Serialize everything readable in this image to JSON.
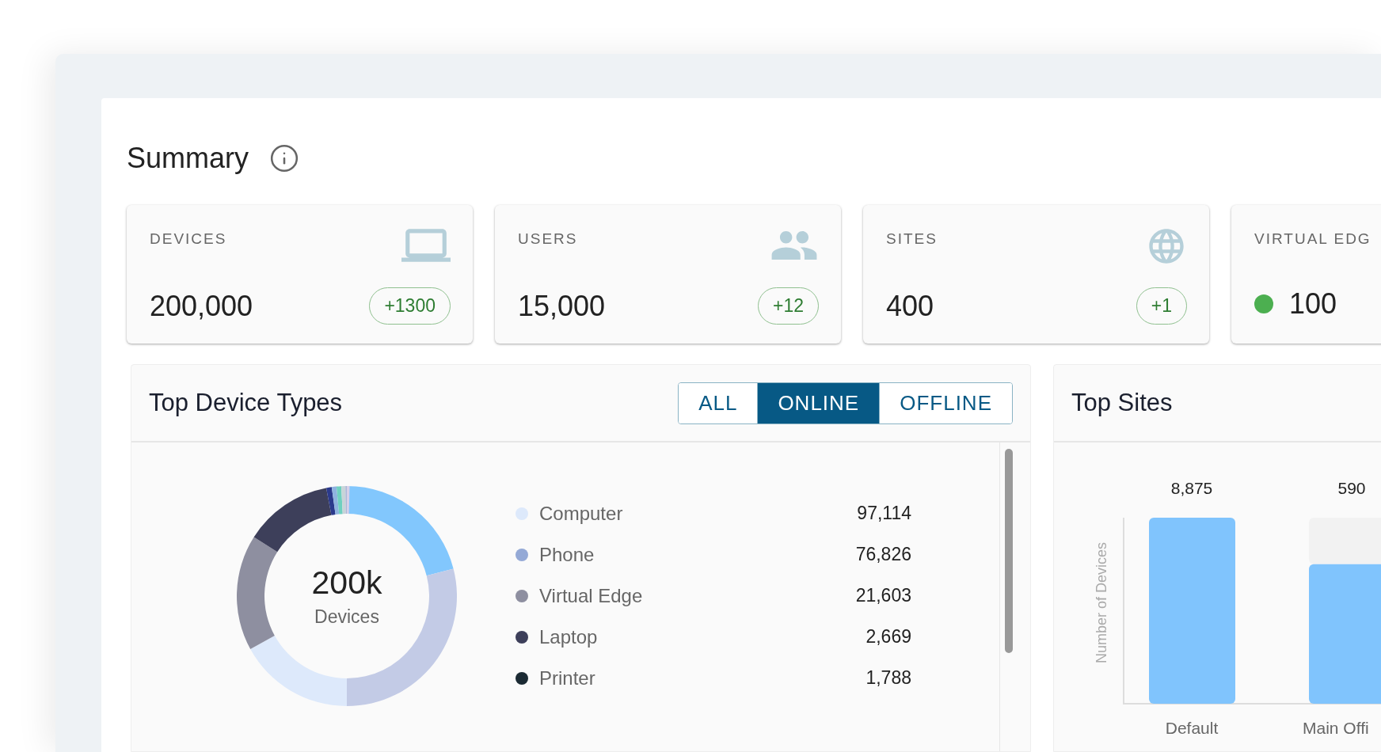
{
  "summary": {
    "title": "Summary"
  },
  "cards": [
    {
      "label": "DEVICES",
      "value": "200,000",
      "badge": "+1300"
    },
    {
      "label": "USERS",
      "value": "15,000",
      "badge": "+12"
    },
    {
      "label": "SITES",
      "value": "400",
      "badge": "+1"
    },
    {
      "label": "VIRTUAL EDG",
      "value": "100",
      "color": "#4caf50"
    }
  ],
  "device_types": {
    "title": "Top Device Types",
    "filters": [
      {
        "label": "ALL",
        "selected": false
      },
      {
        "label": "ONLINE",
        "selected": true
      },
      {
        "label": "OFFLINE",
        "selected": false
      }
    ],
    "center_value": "200k",
    "center_label": "Devices",
    "legend": [
      {
        "label": "Computer",
        "value": "97,114",
        "color": "#dde9fb"
      },
      {
        "label": "Phone",
        "value": "76,826",
        "color": "#94a9d6"
      },
      {
        "label": "Virtual Edge",
        "value": "21,603",
        "color": "#8e8fa0"
      },
      {
        "label": "Laptop",
        "value": "2,669",
        "color": "#3d3f5a"
      },
      {
        "label": "Printer",
        "value": "1,788",
        "color": "#1b2a33"
      }
    ]
  },
  "top_sites": {
    "title": "Top Sites",
    "axis_label": "Number of Devices",
    "bars": [
      {
        "label": "Default",
        "value": "8,875",
        "level": 1
      },
      {
        "label": "Main Offi",
        "value": "590",
        "level": 0.75
      }
    ]
  }
}
